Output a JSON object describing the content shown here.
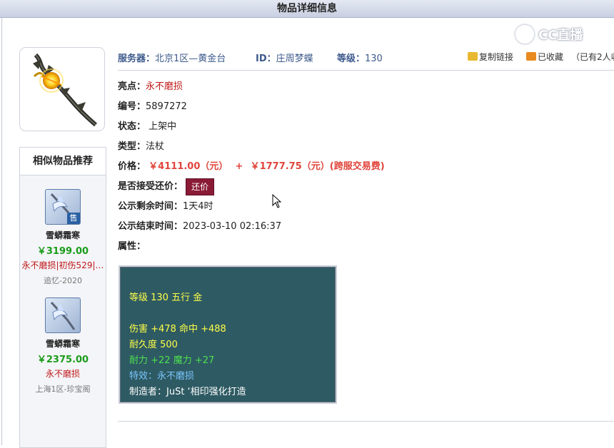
{
  "window": {
    "title": "物品详细信息"
  },
  "watermark": {
    "text": "CC直播"
  },
  "item": {
    "server_label": "服务器：",
    "server_value": "北京1区—黄金台",
    "id_label": "ID：",
    "id_value": "庄周梦蝶",
    "level_label": "等级：",
    "level_value": "130",
    "copy_link": "复制链接",
    "favorited": "已收藏",
    "fav_count": "（已有2人收"
  },
  "details": {
    "shine_label": "亮点：",
    "shine_value": "永不磨损",
    "number_label": "编号：",
    "number_value": "5897272",
    "status_label": "状态：",
    "status_value": "上架中",
    "type_label": "类型：",
    "type_value": "法杖",
    "price_label": "价格：",
    "price_value": "￥4111.00（元）",
    "price_plus": "+",
    "fee_value": "￥1777.75（元）(跨服交易费)",
    "counter_label": "是否接受还价：",
    "counter_button": "还价",
    "remaining_label": "公示剩余时间：",
    "remaining_value": "1天4时",
    "end_label": "公示结束时间：",
    "end_value": "2023-03-10 02:16:37",
    "attr_label": "属性："
  },
  "attributes": {
    "line1": "等级 130 五行 金",
    "line2": "伤害 +478 命中 +488",
    "line3": "耐久度 500",
    "line4": "耐力 +22 魔力 +27",
    "line5": "特效：永不磨损",
    "line6": "制造者：JuSt ‘相印强化打造"
  },
  "recommend": {
    "title": "相似物品推荐",
    "sell_badge": "售",
    "items": [
      {
        "name": "雪蟒霜寒",
        "price": "￥3199.00",
        "attrs": "永不磨损|初伤529|…",
        "seller": "追忆-2020"
      },
      {
        "name": "雪蟒霜寒",
        "price": "￥2375.00",
        "attrs": "永不磨损",
        "seller": "上海1区-珍宝阁"
      }
    ]
  },
  "colors": {
    "accent_blue": "#3d5a8c",
    "price_red": "#e0453c",
    "attr_bg": "#2e5a63",
    "button_bg": "#8a1a36"
  }
}
